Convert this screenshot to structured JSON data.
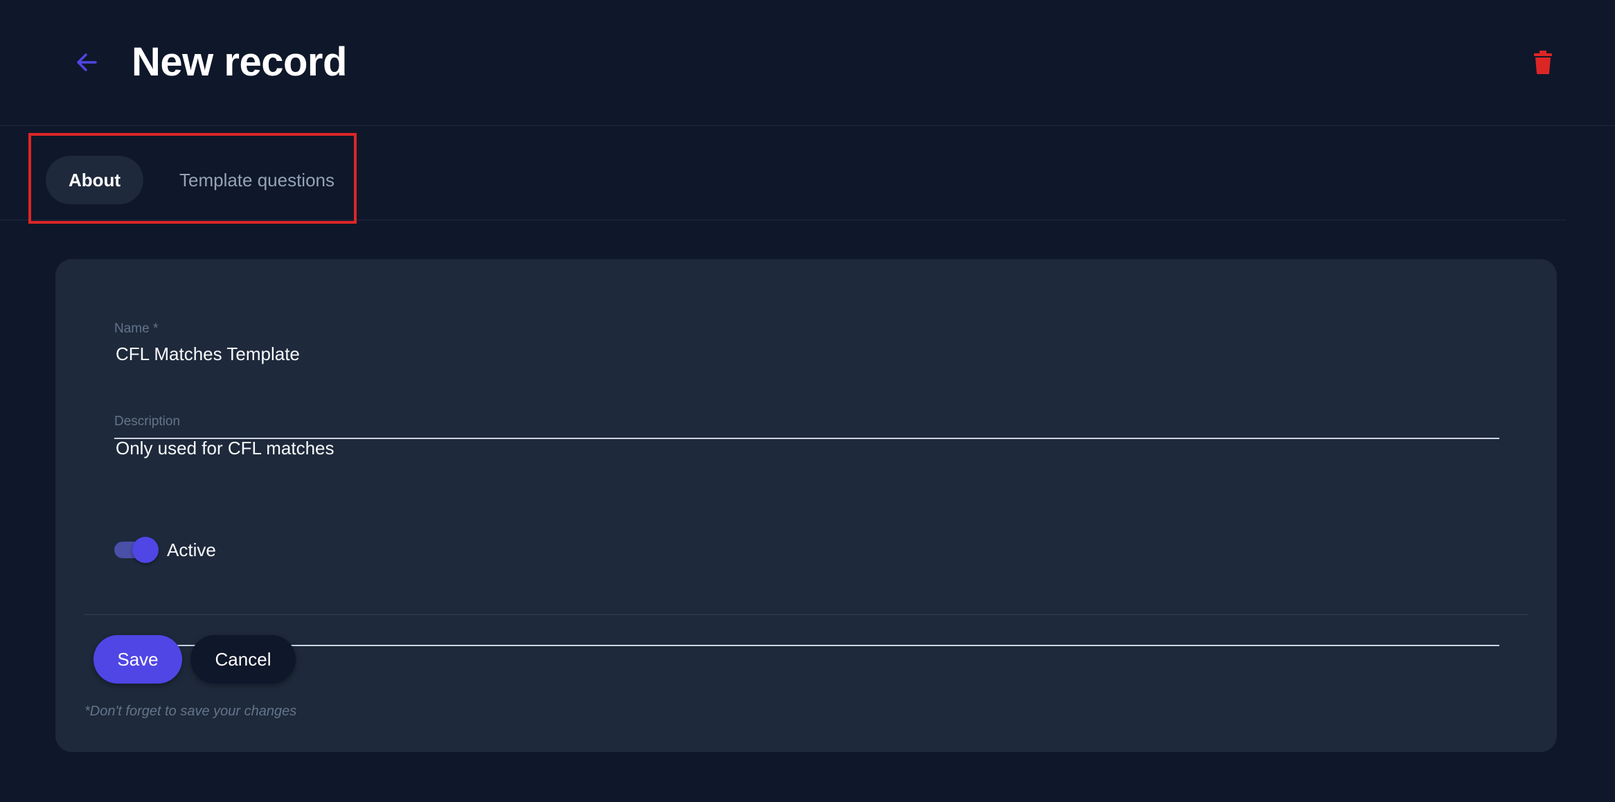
{
  "header": {
    "title": "New record",
    "back_icon": "arrow-left-icon",
    "delete_icon": "trash-icon"
  },
  "tabs": [
    {
      "label": "About",
      "active": true
    },
    {
      "label": "Template questions",
      "active": false
    }
  ],
  "form": {
    "name": {
      "label": "Name *",
      "value": "CFL Matches Template"
    },
    "description": {
      "label": "Description",
      "value": "Only used for CFL matches"
    },
    "active": {
      "label": "Active",
      "checked": true
    }
  },
  "actions": {
    "save_label": "Save",
    "cancel_label": "Cancel",
    "hint": "*Don't forget to save your changes"
  },
  "colors": {
    "background": "#0f172a",
    "card": "#1e293b",
    "accent": "#4f46e5",
    "danger": "#dc2626",
    "highlight": "#dc2626"
  }
}
